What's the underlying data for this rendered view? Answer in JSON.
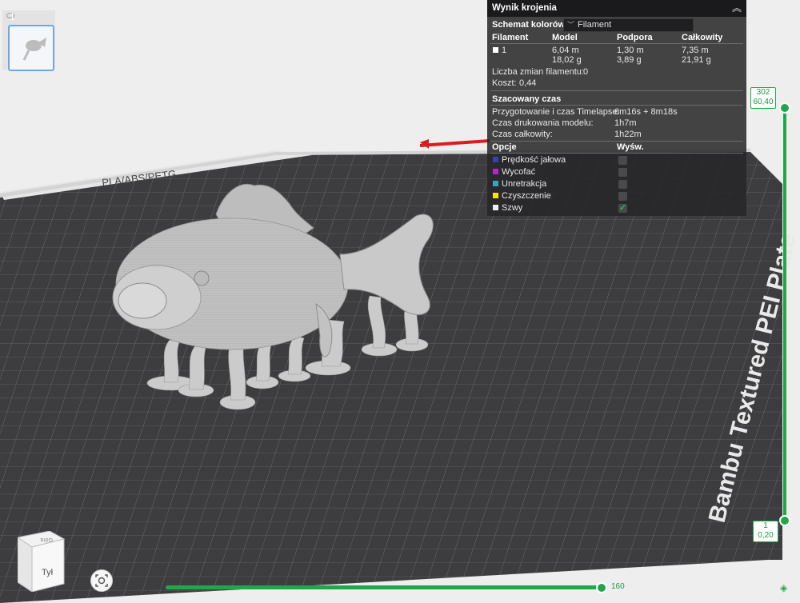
{
  "plate_list": {
    "plate_number": "1"
  },
  "slice_result": {
    "title": "Wynik krojenia",
    "color_scheme_label": "Schemat kolorów",
    "color_scheme_value": "Filament",
    "table": {
      "headers": [
        "Filament",
        "Model",
        "Podpora",
        "Całkowity"
      ],
      "row": {
        "filament": "1",
        "model_length": "6,04 m",
        "model_weight": "18,02 g",
        "support_length": "1,30 m",
        "support_weight": "3,89 g",
        "total_length": "7,35 m",
        "total_weight": "21,91 g"
      }
    },
    "filament_changes_label": "Liczba zmian filamentu:",
    "filament_changes_value": "0",
    "cost_label": "Koszt:",
    "cost_value": "0,44",
    "time_section_title": "Szacowany czas",
    "prep_label": "Przygotowanie i czas Timelapse:",
    "prep_value": "6m16s + 8m18s",
    "print_label": "Czas drukowania modelu:",
    "print_value": "1h7m",
    "total_label": "Czas całkowity:",
    "total_value": "1h22m",
    "options_header": "Opcje",
    "display_header": "Wyśw.",
    "options": [
      {
        "label": "Prędkość jałowa",
        "color": "#3344aa",
        "checked": false
      },
      {
        "label": "Wycofać",
        "color": "#bb22cc",
        "checked": false
      },
      {
        "label": "Unretrakcja",
        "color": "#33a6c8",
        "checked": false
      },
      {
        "label": "Czyszczenie",
        "color": "#f4e21a",
        "checked": false
      },
      {
        "label": "Szwy",
        "color": "#eeeeee",
        "checked": true
      }
    ]
  },
  "layer_slider": {
    "top_layer": "302",
    "top_height": "60,40",
    "bottom_layer": "1",
    "bottom_height": "0,20"
  },
  "move_slider": {
    "value": "160"
  },
  "plate": {
    "label": "Bambu Textured PEI Plate",
    "edge_label": "PLA/ABS/PETG"
  },
  "nav_cube": {
    "front": "Tył",
    "top": "Góra"
  },
  "icons": [
    "eye-icon",
    "chevron-up-icon",
    "chevron-down-icon",
    "layers-icon",
    "view-reset-icon",
    "checkmark-icon"
  ],
  "colors": {
    "accent": "#1fa84a",
    "bed": "#3e3e40",
    "panel": "#262628"
  }
}
